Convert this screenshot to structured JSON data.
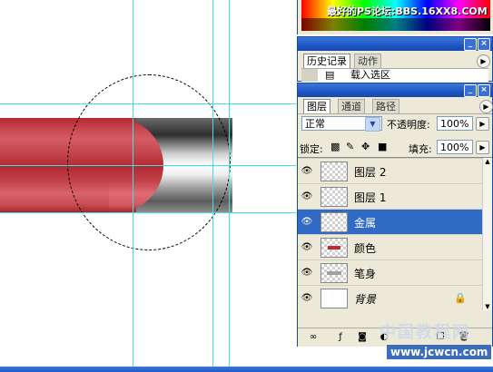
{
  "color_panel": {
    "watermark": "最好的PS论坛:BBS.16XX8.COM"
  },
  "history_panel": {
    "tabs": [
      "历史记录",
      "动作"
    ],
    "items": [
      {
        "icon": "document-icon",
        "label": "载入选区"
      }
    ]
  },
  "layers_panel": {
    "tabs": [
      "图层",
      "通道",
      "路径"
    ],
    "blend_mode": "正常",
    "opacity_label": "不透明度:",
    "opacity_value": "100%",
    "lock_label": "锁定:",
    "fill_label": "填充:",
    "fill_value": "100%",
    "layers": [
      {
        "name": "图层 2",
        "selected": false,
        "thumb": "transparent"
      },
      {
        "name": "图层 1",
        "selected": false,
        "thumb": "transparent"
      },
      {
        "name": "金属",
        "selected": true,
        "thumb": "transparent"
      },
      {
        "name": "颜色",
        "selected": false,
        "thumb": "red-stroke"
      },
      {
        "name": "笔身",
        "selected": false,
        "thumb": "gray-stroke"
      },
      {
        "name": "背景",
        "selected": false,
        "thumb": "white",
        "italic": true,
        "locked": true
      }
    ]
  },
  "watermark": {
    "cn": "中国教程网",
    "url": "www.jcwcn.com"
  },
  "colors": {
    "selected_row": "#316ac5",
    "titlebar": "#1e56c4",
    "guides": "#3fe0e8",
    "pencil_red": "#c5434c"
  }
}
